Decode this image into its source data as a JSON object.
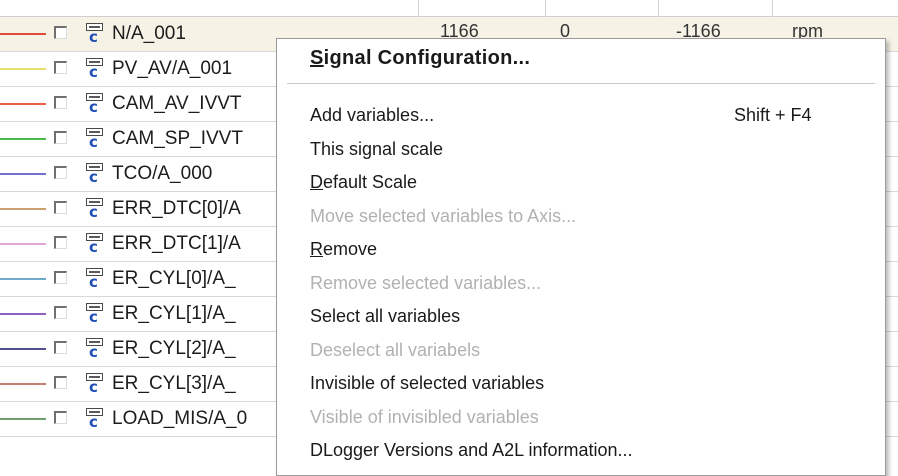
{
  "rows": [
    {
      "name": "N/A_001",
      "color": "#e04a3a",
      "selected": true,
      "val1": "1166",
      "val2": "0",
      "val3": "-1166",
      "unit": "rpm"
    },
    {
      "name": "PV_AV/A_001",
      "color": "#e8e070"
    },
    {
      "name": "CAM_AV_IVVT",
      "color": "#e86040"
    },
    {
      "name": "CAM_SP_IVVT",
      "color": "#4cb84c"
    },
    {
      "name": "TCO/A_000",
      "color": "#7070d0"
    },
    {
      "name": "ERR_DTC[0]/A",
      "color": "#c8a070"
    },
    {
      "name": "ERR_DTC[1]/A",
      "color": "#e0a8d8"
    },
    {
      "name": "ER_CYL[0]/A_",
      "color": "#70a8c8"
    },
    {
      "name": "ER_CYL[1]/A_",
      "color": "#9060c0"
    },
    {
      "name": "ER_CYL[2]/A_",
      "color": "#505090"
    },
    {
      "name": "ER_CYL[3]/A_",
      "color": "#c08070"
    },
    {
      "name": "LOAD_MIS/A_0",
      "color": "#70a070"
    }
  ],
  "menu": {
    "header": {
      "prefix": "",
      "ul": "S",
      "rest": "ignal Configuration..."
    },
    "items": [
      {
        "prefix": "",
        "ul": "",
        "rest": "Add variables...",
        "shortcut": "Shift + F4",
        "disabled": false
      },
      {
        "prefix": "",
        "ul": "",
        "rest": "This signal scale",
        "disabled": false
      },
      {
        "prefix": "",
        "ul": "D",
        "rest": "efault Scale",
        "disabled": false
      },
      {
        "prefix": "",
        "ul": "",
        "rest": "Move selected variables to Axis...",
        "disabled": true
      },
      {
        "prefix": "",
        "ul": "R",
        "rest": "emove",
        "disabled": false
      },
      {
        "prefix": "",
        "ul": "",
        "rest": "Remove selected variables...",
        "disabled": true
      },
      {
        "prefix": "",
        "ul": "",
        "rest": "Select all variables",
        "disabled": false
      },
      {
        "prefix": "",
        "ul": "",
        "rest": "Deselect all variabels",
        "disabled": true
      },
      {
        "prefix": "",
        "ul": "",
        "rest": "Invisible of selected variables",
        "disabled": false
      },
      {
        "prefix": "",
        "ul": "",
        "rest": "Visible of invisibled variables",
        "disabled": true
      },
      {
        "prefix": "",
        "ul": "",
        "rest": "DLogger Versions and A2L information...",
        "disabled": false
      }
    ]
  }
}
